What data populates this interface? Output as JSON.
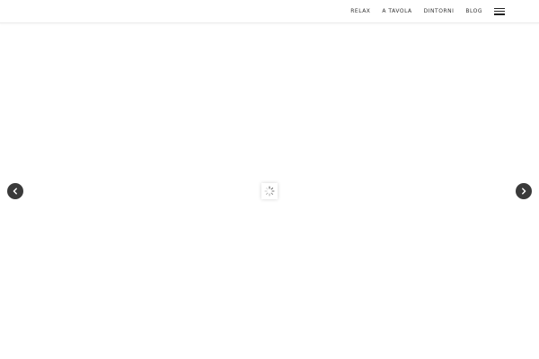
{
  "nav": {
    "items": [
      {
        "label": "RELAX"
      },
      {
        "label": "A TAVOLA"
      },
      {
        "label": "DINTORNI"
      },
      {
        "label": "BLOG"
      }
    ],
    "menu_icon": "hamburger-menu-icon"
  },
  "slider": {
    "prev_icon": "chevron-left-icon",
    "next_icon": "chevron-right-icon",
    "loading_icon": "spinner-icon"
  },
  "colors": {
    "arrow_bg": "#3a3a3a",
    "text": "#333333"
  }
}
